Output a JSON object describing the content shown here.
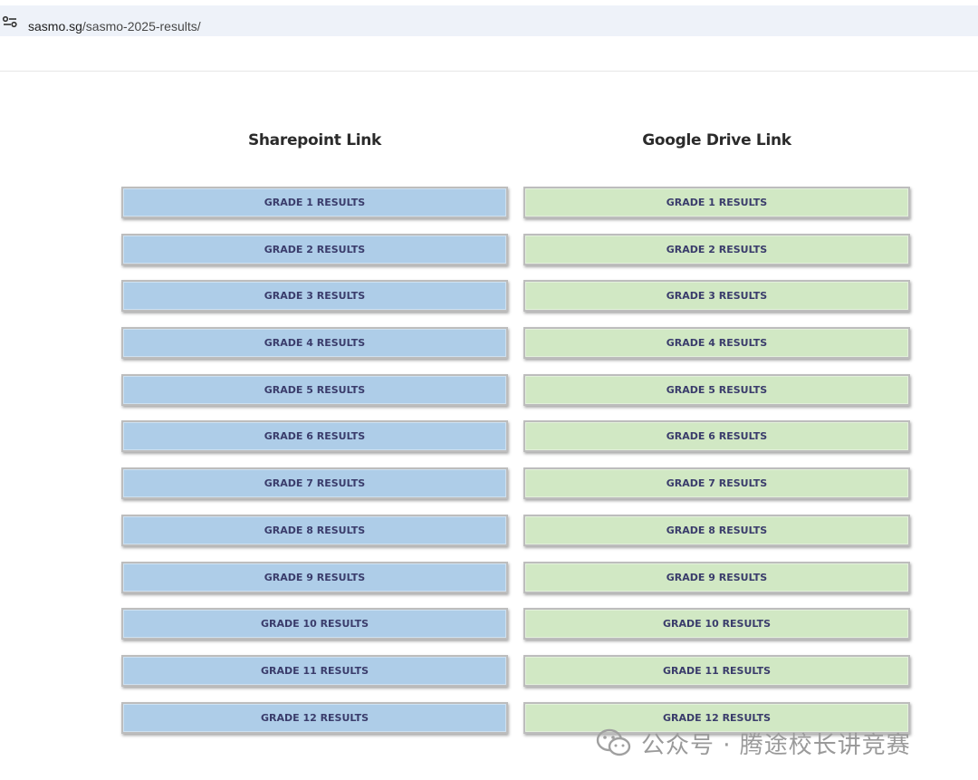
{
  "browser": {
    "url_domain": "sasmo.sg",
    "url_path": "/sasmo-2025-results/"
  },
  "columns": {
    "left": {
      "title": "Sharepoint Link",
      "color": "#aecde8",
      "buttons": [
        "GRADE 1 RESULTS",
        "GRADE 2 RESULTS",
        "GRADE 3 RESULTS",
        "GRADE 4 RESULTS",
        "GRADE 5 RESULTS",
        "GRADE 6 RESULTS",
        "GRADE 7 RESULTS",
        "GRADE 8 RESULTS",
        "GRADE 9 RESULTS",
        "GRADE 10 RESULTS",
        "GRADE 11 RESULTS",
        "GRADE 12 RESULTS"
      ]
    },
    "right": {
      "title": "Google Drive Link",
      "color": "#d1e8c4",
      "buttons": [
        "GRADE 1 RESULTS",
        "GRADE 2 RESULTS",
        "GRADE 3 RESULTS",
        "GRADE 4 RESULTS",
        "GRADE 5 RESULTS",
        "GRADE 6 RESULTS",
        "GRADE 7 RESULTS",
        "GRADE 8 RESULTS",
        "GRADE 9 RESULTS",
        "GRADE 10 RESULTS",
        "GRADE 11 RESULTS",
        "GRADE 12 RESULTS"
      ]
    }
  },
  "watermark": {
    "text": "公众号 · 腾途校长讲竞赛",
    "icon": "wechat-icon"
  }
}
